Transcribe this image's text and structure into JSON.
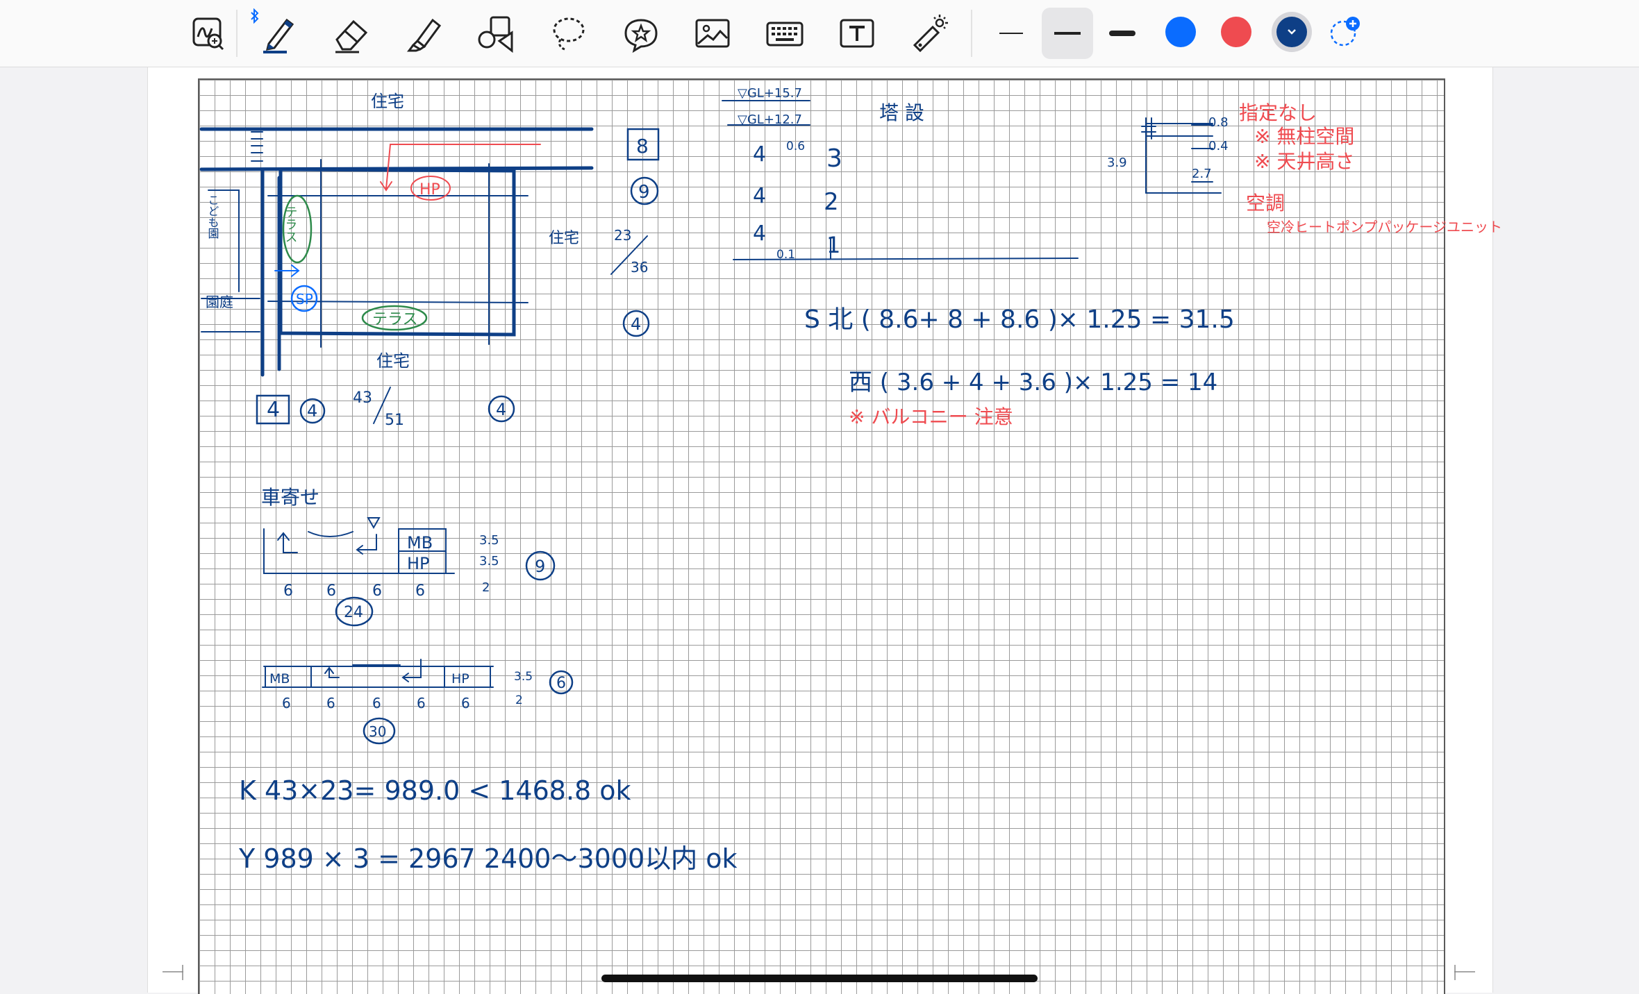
{
  "toolbar": {
    "tools": [
      {
        "name": "zoom-window-tool"
      },
      {
        "name": "pen-tool"
      },
      {
        "name": "eraser-tool"
      },
      {
        "name": "highlighter-tool"
      },
      {
        "name": "shapes-tool"
      },
      {
        "name": "lasso-tool"
      },
      {
        "name": "stickers-tool"
      },
      {
        "name": "image-tool"
      },
      {
        "name": "keyboard-tool"
      },
      {
        "name": "text-box-tool"
      },
      {
        "name": "laser-pointer-tool"
      }
    ],
    "stroke_widths": [
      "thin",
      "medium",
      "thick"
    ],
    "selected_stroke_width": "medium",
    "colors": [
      "#0a6cff",
      "#ef4b50",
      "#0e3f86"
    ],
    "selected_color": "#0e3f86"
  },
  "sketch": {
    "top_label": "住宅",
    "left_labels": [
      "こども園",
      "園庭"
    ],
    "right_label": "住宅",
    "bottom_label": "住宅",
    "hp": "HP",
    "terrace_v": "テラス",
    "sp": "SP",
    "terrace_h": "テラス",
    "box_8": "8",
    "circle_9": "9",
    "frac_top": "23",
    "frac_bottom": "36",
    "circle_4": "4",
    "box_4": "4",
    "circle_4b": "4",
    "frac2_top": "43",
    "frac2_bottom": "51",
    "circle_4c": "4"
  },
  "parking": {
    "title": "車寄せ",
    "mb": "MB",
    "hp": "HP",
    "dims1": [
      "6",
      "6",
      "6",
      "6"
    ],
    "side_vals1": [
      "3.5",
      "3.5",
      "2"
    ],
    "circle_9": "9",
    "total1": "24",
    "mb2": "MB",
    "hp2": "HP",
    "dims2": [
      "6",
      "6",
      "6",
      "6",
      "6"
    ],
    "side_vals2": [
      "3.5",
      "2"
    ],
    "circle_6": "6",
    "total2": "30"
  },
  "calc": {
    "k_line": "K  43×23= 989.0  <  1468.8      ok",
    "y_line": "Y  989 × 3 =  2967    2400〜3000以内    ok"
  },
  "section": {
    "gl1": "▽GL+15.7",
    "gl2": "▽GL+12.7",
    "title": "塔  設",
    "heights": [
      "4",
      "4",
      "4"
    ],
    "small1": "0.6",
    "small2": "0.1",
    "counts": [
      "3",
      "2",
      "1"
    ],
    "s_line": "S  北  ( 8.6+ 8 + 8.6 )× 1.25  =  31.5",
    "w_line": "西  ( 3.6 + 4 + 3.6 )× 1.25  =  14",
    "note": "※ バルコニー 注意"
  },
  "elev": {
    "left": "3.9",
    "v1": "0.8",
    "v2": "0.4",
    "v3": "2.7"
  },
  "red_notes": {
    "line1": "指定なし",
    "line2": "※ 無柱空間",
    "line3": "※ 天井高さ",
    "line4": "空調",
    "line5": "空冷ヒートポンプパッケージユニット"
  }
}
